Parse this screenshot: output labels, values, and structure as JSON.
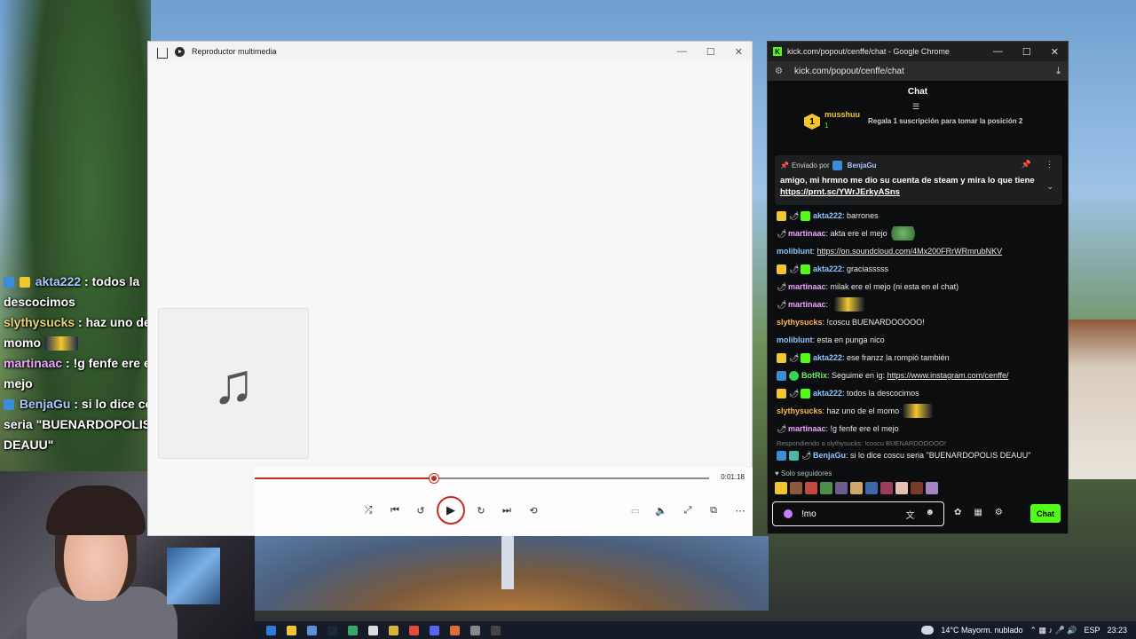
{
  "overlay_chat": [
    {
      "user": "akta222",
      "text": " : todos la descocimos"
    },
    {
      "user": "slythysucks",
      "text": " : haz uno de el momo"
    },
    {
      "user": "martinaac",
      "text": " : !g fenfe ere el mejo"
    },
    {
      "user": "BenjaGu",
      "text": " : si lo dice coscu seria \"BUENARDOPOLIS DEAUU\""
    }
  ],
  "media_player": {
    "title": "Reproductor multimedia",
    "time": "0:01:18",
    "progress": 0.395,
    "art_icon": "music-note-icon"
  },
  "chrome": {
    "window_title": "kick.com/popout/cenffe/chat - Google Chrome",
    "url": "kick.com/popout/cenffe/chat",
    "chat_header": "Chat",
    "leaderboard": {
      "rank": "1",
      "user": "musshuu",
      "subs": "1",
      "gift_prompt": "Regala 1 suscripción para tomar la posición 2"
    },
    "pinned": {
      "sent_by_label": "Enviado por",
      "user": "BenjaGu",
      "message": "amigo, mi hrmno me dio su cuenta de steam y mira lo que tiene",
      "link": "https://prnt.sc/YWrJErkyASns"
    },
    "messages": [
      {
        "badges": [
          "crown",
          "pep",
          "sub"
        ],
        "user": "akta222",
        "color": "c-blue",
        "text": "barrones"
      },
      {
        "badges": [
          "pep"
        ],
        "user": "martinaac",
        "color": "c-pink",
        "text": "akta ere el mejo",
        "emote": "frog"
      },
      {
        "badges": [],
        "user": "moliblunt",
        "color": "c-blue",
        "link": "https://on.soundcloud.com/4Mx200FRrWRmrubNKV"
      },
      {
        "badges": [
          "crown",
          "pep",
          "sub"
        ],
        "user": "akta222",
        "color": "c-blue",
        "text": "graciasssss"
      },
      {
        "badges": [
          "pep"
        ],
        "user": "martinaac",
        "color": "c-pink",
        "text": "milak ere el mejo (ni esta en el chat)"
      },
      {
        "badges": [
          "pep"
        ],
        "user": "martinaac",
        "color": "c-pink",
        "text": "",
        "emote": "taxi"
      },
      {
        "badges": [],
        "user": "slythysucks",
        "color": "c-orange",
        "text": "!coscu BUENARDOOOOO!"
      },
      {
        "badges": [],
        "user": "moliblunt",
        "color": "c-blue",
        "text": "esta en punga nico"
      },
      {
        "badges": [
          "crown",
          "pep",
          "sub"
        ],
        "user": "akta222",
        "color": "c-blue",
        "text": "ese franzz la rompió también"
      },
      {
        "badges": [
          "blue",
          "mod"
        ],
        "user": "BotRix",
        "color": "c-lime",
        "text": "Seguime en ig: ",
        "link": "https://www.instagram.com/cenffe/"
      },
      {
        "badges": [
          "crown",
          "pep",
          "sub"
        ],
        "user": "akta222",
        "color": "c-blue",
        "text": "todos la descocimos"
      },
      {
        "badges": [],
        "user": "slythysucks",
        "color": "c-orange",
        "text": "haz uno de el momo",
        "emote": "taxi"
      },
      {
        "badges": [
          "pep"
        ],
        "user": "martinaac",
        "color": "c-pink",
        "text": "!g fenfe ere el mejo"
      }
    ],
    "reply": {
      "label": "Respondiendo a slythysucks: !coscu BUENARDOOOOO!",
      "user": "BenjaGu",
      "text": "si lo dice coscu seria \"BUENARDOPOLIS DEAUU\""
    },
    "followers_label": "Solo seguidores",
    "composer_value": "!mo",
    "send_label": "Chat"
  },
  "taskbar": {
    "weather": "14°C  Mayorm. nublado",
    "lang": "ESP",
    "clock": "23:23"
  }
}
